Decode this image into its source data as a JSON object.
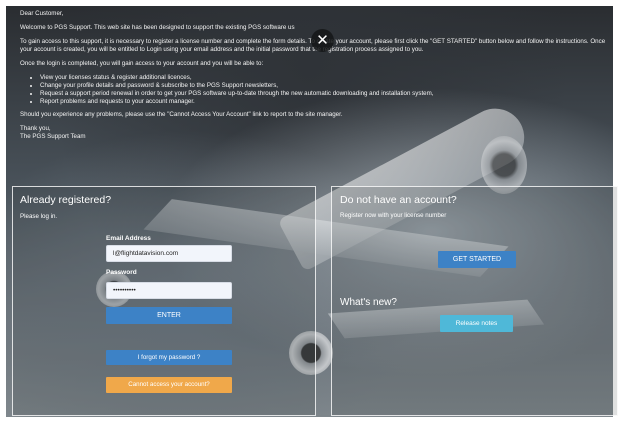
{
  "notice": {
    "greeting": "Dear Customer,",
    "intro": "Welcome to PGS Support. This web site has been designed to support the existing PGS software us",
    "p2": "To gain access to this support, it is necessary to register a license number and complete the form details. To create your account, please first click the \"GET STARTED\" button below and follow the instructions. Once your account is created, you will be entitled to Login using your email address and the initial password that the registration process assigned to you.",
    "p3": "Once the login is completed, you will gain access to your account and you will be able to:",
    "list": [
      "View your licenses status & register additional licences,",
      "Change your profile details and password & subscribe to the PGS Support newsletters,",
      "Request a support period renewal in order to get your PGS software up-to-date through the new automatic downloading and installation system,",
      "Report problems and requests to your account manager."
    ],
    "p4": "Should you experience any problems, please use the \"Cannot Access Your Account\" link to report to the site manager.",
    "thanks": "Thank you,",
    "team": "The PGS Support Team",
    "close_glyph": "✕"
  },
  "login": {
    "title": "Already registered?",
    "subtitle": "Please log in.",
    "email_label": "Email Address",
    "email_value": "l@flightdatavision.com",
    "password_label": "Password",
    "password_value": "••••••••••",
    "enter_label": "ENTER",
    "forgot_label": "I forgot my password ?",
    "cannot_access_label": "Cannot access your account?"
  },
  "signup": {
    "title": "Do not have an account?",
    "subtitle": "Register now with your license number",
    "get_started_label": "GET STARTED",
    "whats_new_title": "What's new?",
    "release_notes_label": "Release notes"
  },
  "colors": {
    "primary_button": "#3d82c6",
    "release_button": "#4fb8d8",
    "warning_button": "#f0a84a"
  }
}
